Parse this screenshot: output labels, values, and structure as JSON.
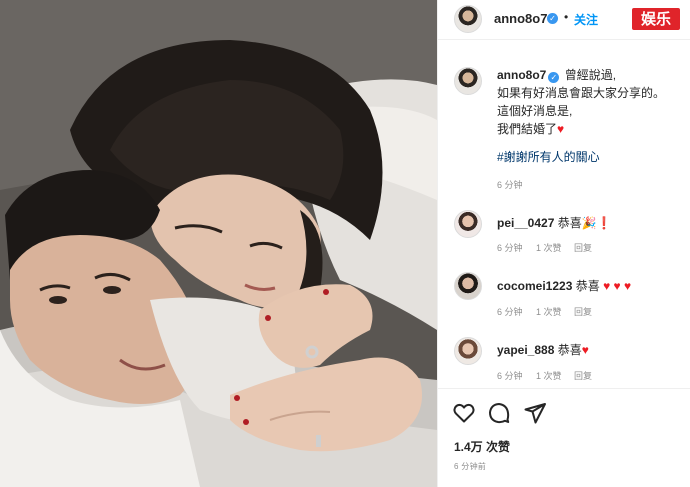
{
  "post": {
    "username": "anno8o7",
    "follow_label": "关注",
    "dot": "•",
    "watermark": "娱乐"
  },
  "caption": {
    "username": "anno8o7",
    "lines": [
      "曾經說過,",
      "如果有好消息會跟大家分享的。",
      "這個好消息是,",
      "我們結婚了"
    ],
    "heart": "♥",
    "hashtag": "#謝謝所有人的關心",
    "time": "6 分钟"
  },
  "comments": [
    {
      "username": "pei__0427",
      "text": "恭喜🎉❗",
      "time": "6 分钟",
      "likes": "1 次赞",
      "reply": "回复"
    },
    {
      "username": "cocomei1223",
      "text": "恭喜",
      "hearts": "♥ ♥ ♥",
      "time": "6 分钟",
      "likes": "1 次赞",
      "reply": "回复"
    },
    {
      "username": "yapei_888",
      "text": "恭喜",
      "hearts": "♥",
      "time": "6 分钟",
      "likes": "1 次赞",
      "reply": "回复"
    }
  ],
  "footer": {
    "likes": "1.4万 次赞",
    "time_ago": "6 分钟前"
  },
  "icons": {
    "like": "heart-outline-icon",
    "comment": "comment-bubble-icon",
    "share": "paper-plane-icon",
    "verified": "verified-badge-icon"
  },
  "colors": {
    "link": "#0095f6",
    "hashtag": "#00376b",
    "verified": "#3897f0",
    "heart": "#ed1c24",
    "watermark_bg": "#e0242a"
  }
}
